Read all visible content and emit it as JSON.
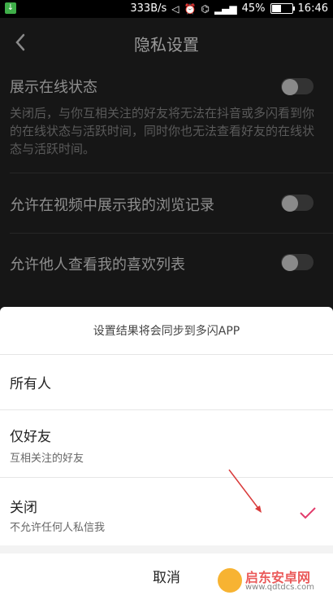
{
  "status_bar": {
    "speed": "333B/s",
    "battery_percent": "45%",
    "time": "16:46"
  },
  "header": {
    "title": "隐私设置"
  },
  "settings": [
    {
      "label": "展示在线状态",
      "description": "关闭后，与你互相关注的好友将无法在抖音或多闪看到你的在线状态与活跃时间，同时你也无法查看好友的在线状态与活跃时间。",
      "toggle_on": false
    },
    {
      "label": "允许在视频中展示我的浏览记录",
      "toggle_on": false
    },
    {
      "label": "允许他人查看我的喜欢列表",
      "toggle_on": false
    }
  ],
  "sheet": {
    "header": "设置结果将会同步到多闪APP",
    "options": [
      {
        "title": "所有人",
        "subtitle": ""
      },
      {
        "title": "仅好友",
        "subtitle": "互相关注的好友"
      },
      {
        "title": "关闭",
        "subtitle": "不允许任何人私信我",
        "selected": true
      }
    ],
    "cancel": "取消"
  },
  "watermark": {
    "name": "启东安卓网",
    "url": "www.qdtdcs.com"
  },
  "colors": {
    "check": "#e23b6b",
    "arrow": "#d93b3b"
  }
}
